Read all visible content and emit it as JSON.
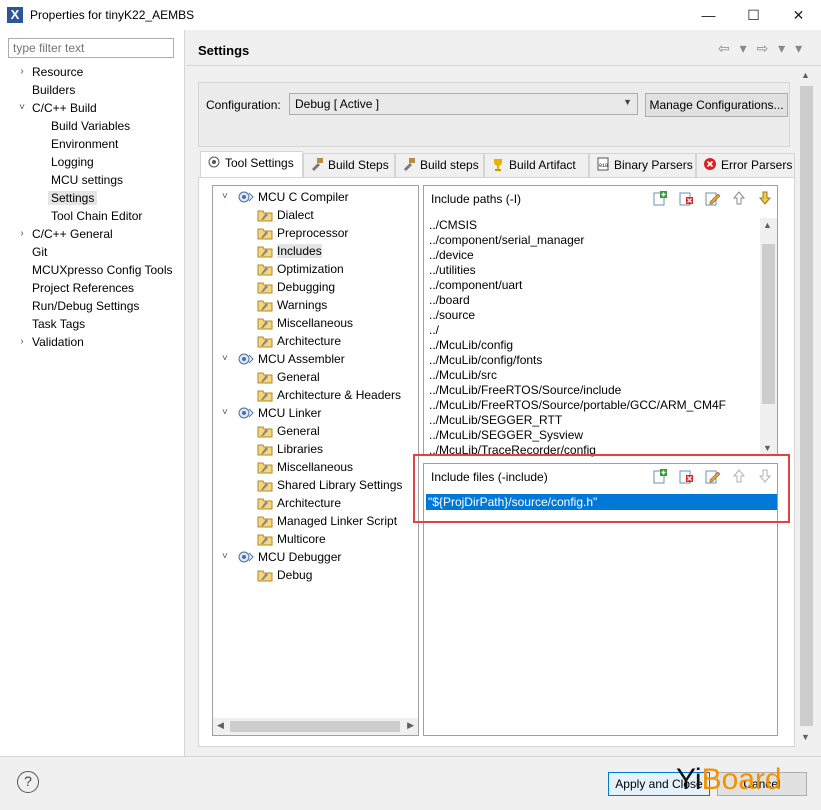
{
  "window": {
    "title": "Properties for tinyK22_AEMBS",
    "min": "—",
    "max": "☐",
    "close": "✕"
  },
  "filter": {
    "placeholder": "type filter text"
  },
  "nav": [
    {
      "label": "Resource",
      "tw": "›"
    },
    {
      "label": "Builders",
      "tw": ""
    },
    {
      "label": "C/C++ Build",
      "tw": "˅"
    },
    {
      "label": "Build Variables",
      "tw": ""
    },
    {
      "label": "Environment",
      "tw": ""
    },
    {
      "label": "Logging",
      "tw": ""
    },
    {
      "label": "MCU settings",
      "tw": ""
    },
    {
      "label": "Settings",
      "tw": ""
    },
    {
      "label": "Tool Chain Editor",
      "tw": ""
    },
    {
      "label": "C/C++ General",
      "tw": "›"
    },
    {
      "label": "Git",
      "tw": ""
    },
    {
      "label": "MCUXpresso Config Tools",
      "tw": ""
    },
    {
      "label": "Project References",
      "tw": ""
    },
    {
      "label": "Run/Debug Settings",
      "tw": ""
    },
    {
      "label": "Task Tags",
      "tw": ""
    },
    {
      "label": "Validation",
      "tw": "›"
    }
  ],
  "header": {
    "title": "Settings",
    "nav_arrows": "⇦ ▾ ⇨ ▾ ▾"
  },
  "config": {
    "label": "Configuration:",
    "value": "Debug  [ Active ]",
    "manage": "Manage Configurations..."
  },
  "tabs": [
    {
      "label": "Tool Settings",
      "icon": "tool-settings-icon"
    },
    {
      "label": "Build Steps",
      "icon": "build-steps-icon"
    },
    {
      "label": "Build steps",
      "icon": "build-steps-icon"
    },
    {
      "label": "Build Artifact",
      "icon": "build-artifact-icon"
    },
    {
      "label": "Binary Parsers",
      "icon": "binary-parsers-icon"
    },
    {
      "label": "Error Parsers",
      "icon": "error-parsers-icon"
    }
  ],
  "tree": [
    {
      "label": "MCU C Compiler",
      "tw": "˅"
    },
    {
      "label": "Dialect"
    },
    {
      "label": "Preprocessor"
    },
    {
      "label": "Includes"
    },
    {
      "label": "Optimization"
    },
    {
      "label": "Debugging"
    },
    {
      "label": "Warnings"
    },
    {
      "label": "Miscellaneous"
    },
    {
      "label": "Architecture"
    },
    {
      "label": "MCU Assembler",
      "tw": "˅"
    },
    {
      "label": "General"
    },
    {
      "label": "Architecture & Headers"
    },
    {
      "label": "MCU Linker",
      "tw": "˅"
    },
    {
      "label": "General"
    },
    {
      "label": "Libraries"
    },
    {
      "label": "Miscellaneous"
    },
    {
      "label": "Shared Library Settings"
    },
    {
      "label": "Architecture"
    },
    {
      "label": "Managed Linker Script"
    },
    {
      "label": "Multicore"
    },
    {
      "label": "MCU Debugger",
      "tw": "˅"
    },
    {
      "label": "Debug"
    }
  ],
  "include_paths": {
    "title": "Include paths (-I)",
    "items": [
      "../CMSIS",
      "../component/serial_manager",
      "../device",
      "../utilities",
      "../component/uart",
      "../board",
      "../source",
      "../",
      "../McuLib/config",
      "../McuLib/config/fonts",
      "../McuLib/src",
      "../McuLib/FreeRTOS/Source/include",
      "../McuLib/FreeRTOS/Source/portable/GCC/ARM_CM4F",
      "../McuLib/SEGGER_RTT",
      "../McuLib/SEGGER_Sysview",
      "../McuLib/TraceRecorder/config"
    ]
  },
  "include_files": {
    "title": "Include files (-include)",
    "items": [
      "\"${ProjDirPath}/source/config.h\""
    ]
  },
  "footer": {
    "help": "?",
    "apply": "Apply and Close",
    "cancel": "Cancel"
  },
  "watermark": {
    "part1": "Yi",
    "part2": "Board"
  },
  "colors": {
    "selection": "#0078d7",
    "highlight_box": "#e04343",
    "watermark_accent": "#f39200"
  }
}
